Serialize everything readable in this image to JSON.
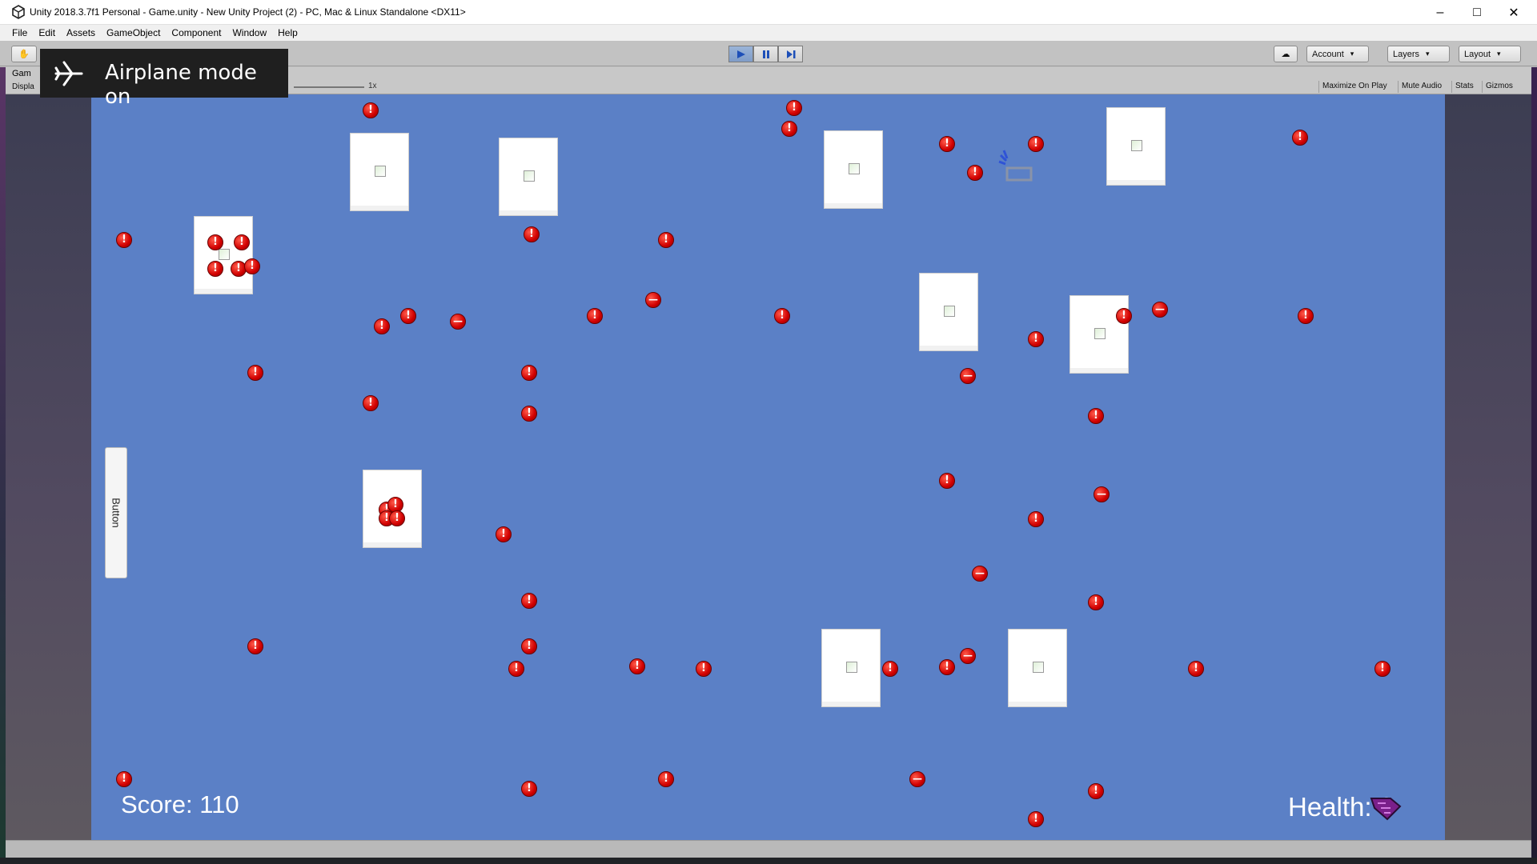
{
  "titlebar": {
    "title": "Unity 2018.3.7f1 Personal - Game.unity - New Unity Project (2) - PC, Mac & Linux Standalone <DX11>",
    "minimize_icon": "minimize-icon",
    "maximize_icon": "maximize-icon",
    "close_icon": "close-icon"
  },
  "menubar": {
    "items": [
      "File",
      "Edit",
      "Assets",
      "GameObject",
      "Component",
      "Window",
      "Help"
    ]
  },
  "toolbar": {
    "account": "Account",
    "layers": "Layers",
    "layout": "Layout",
    "play_state": "playing"
  },
  "game_view": {
    "tab": "Gam",
    "display": "Displa",
    "scale": "1x",
    "maximize_on_play": "Maximize On Play",
    "mute_audio": "Mute Audio",
    "stats": "Stats",
    "gizmos": "Gizmos"
  },
  "game": {
    "button_label": "Button",
    "score_text": "Score: 110",
    "health_text": "Health: 3",
    "cards": 10,
    "error_icon": "error-icon"
  },
  "toast": {
    "text": "Airplane mode on",
    "icon": "airplane-icon"
  },
  "colors": {
    "game_background": "#5b80c6",
    "error_red": "#d10000",
    "toast_background": "#1f1f1f"
  }
}
